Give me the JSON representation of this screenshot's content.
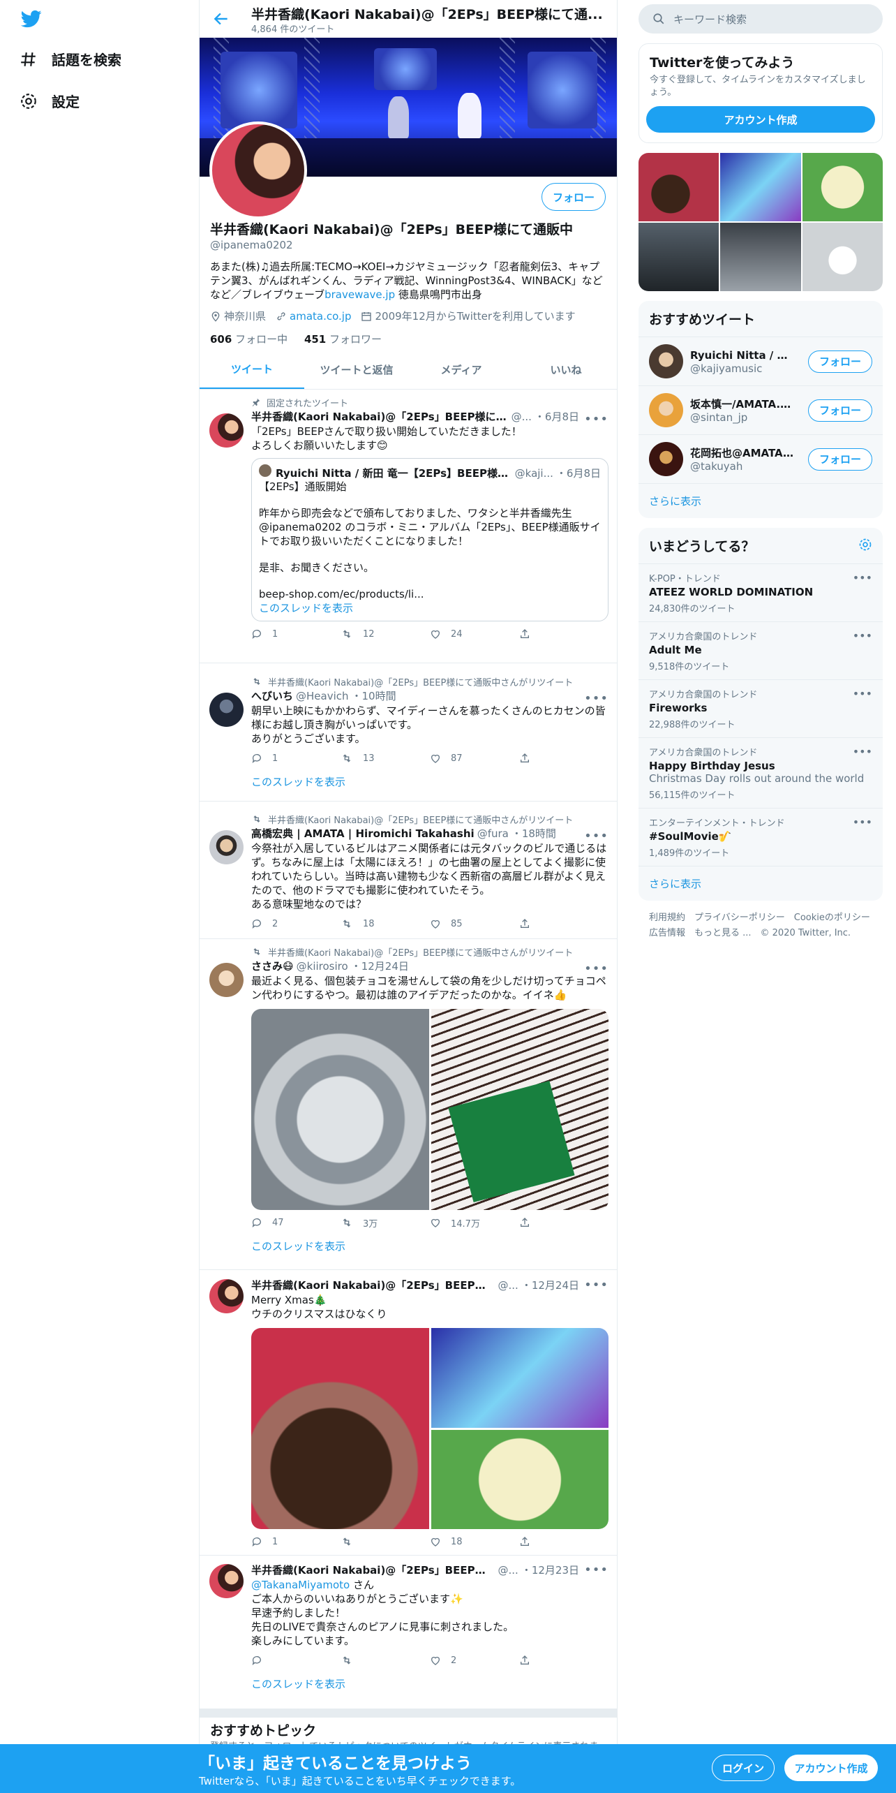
{
  "nav": {
    "explore": "話題を検索",
    "settings": "設定"
  },
  "header": {
    "title": "半井香織(Kaori Nakabai)@「2EPs」BEEP様にて通...",
    "subtitle": "4,864 件のツイート"
  },
  "profile": {
    "follow": "フォロー",
    "name": "半井香織(Kaori Nakabai)@「2EPs」BEEP様にて通販中",
    "handle": "@ipanema0202",
    "bio": "あまた(株)♫過去所属:TECMO→KOEI→カジヤミュージック「忍者龍剣伝3、キャプテン翼3、がんばれギンくん、ラディア戦記、WinningPost3&4、WINBACK」などなど／ブレイブウェーブ",
    "bio_link": "bravewave.jp",
    "bio_tail": " 徳島県鳴門市出身",
    "location": "神奈川県",
    "url": "amata.co.jp",
    "joined": "2009年12月からTwitterを利用しています",
    "following_count": "606",
    "following_label": " フォロー中",
    "followers_count": "451",
    "followers_label": " フォロワー"
  },
  "tabs": [
    "ツイート",
    "ツイートと返信",
    "メディア",
    "いいね"
  ],
  "tweets": {
    "t1": {
      "pinned": "固定されたツイート",
      "name": "半井香織(Kaori Nakabai)@「2EPs」BEEP様にて通販中",
      "handle": "@...",
      "time": "・6月8日",
      "text1": "「2EPs」BEEPさんで取り扱い開始していただきました！",
      "text2": "よろしくお願いいたします😊",
      "quote": {
        "name": "Ryuichi Nitta / 新田 竜一【2EPs】BEEP様にて通販中",
        "handle": "@kaji...",
        "time": "・6月8日",
        "l1": "【2EPs】通販開始",
        "l2": "昨年から即売会などで頒布しておりました、ワタシと半井香織先生@ipanema0202 のコラボ・ミニ・アルバム「2EPs」、BEEP様通販サイトでお取り扱いいただくことになりました！",
        "l3": "是非、お聞きください。",
        "l4": "beep-shop.com/ec/products/li...",
        "thread": "このスレッドを表示"
      },
      "replies": "1",
      "retweets": "12",
      "likes": "24"
    },
    "t2": {
      "ctx": "半井香織(Kaori Nakabai)@「2EPs」BEEP様にて通販中さんがリツイート",
      "name": "へびいち",
      "handle": "@Heavich",
      "time": "・10時間",
      "text": "朝早い上映にもかかわらず、マイディーさんを慕ったくさんのヒカセンの皆様にお越し頂き胸がいっぱいです。",
      "text2": "ありがとうございます。",
      "replies": "1",
      "retweets": "13",
      "likes": "87",
      "thread": "このスレッドを表示"
    },
    "t3": {
      "ctx": "半井香織(Kaori Nakabai)@「2EPs」BEEP様にて通販中さんがリツイート",
      "name": "高橋宏典 | AMATA | Hiromichi Takahashi",
      "handle": "@fura",
      "time": "・18時間",
      "text": "今祭社が入居しているビルはアニメ関係者には元タバックのビルで通じるはず。ちなみに屋上は「太陽にほえろ！」の七曲署の屋上としてよく撮影に使われていたらしい。当時は高い建物も少なく西新宿の高層ビル群がよく見えたので、他のドラマでも撮影に使われていたそう。",
      "text2": "ある意味聖地なのでは？",
      "replies": "2",
      "retweets": "18",
      "likes": "85"
    },
    "t4": {
      "ctx": "半井香織(Kaori Nakabai)@「2EPs」BEEP様にて通販中さんがリツイート",
      "name": "ささみ😷",
      "handle": "@kiirosiro",
      "time": "・12月24日",
      "text": "最近よく見る、個包装チョコを湯せんして袋の角を少しだけ切ってチョコペン代わりにするやつ。最初は誰のアイデアだったのかな。イイネ👍",
      "replies": "47",
      "retweets": "3万",
      "likes": "14.7万",
      "thread": "このスレッドを表示"
    },
    "t5": {
      "name": "半井香織(Kaori Nakabai)@「2EPs」BEEP様にて通販中",
      "handle": "@...",
      "time": "・12月24日",
      "text": "Merry Xmas🎄",
      "text2": "ウチのクリスマスはひなくり",
      "replies": "1",
      "retweets": "",
      "likes": "18"
    },
    "t6": {
      "name": "半井香織(Kaori Nakabai)@「2EPs」BEEP様にて通販中",
      "handle": "@...",
      "time": "・12月23日",
      "mention": "@TakanaMiyamoto",
      "mention_tail": " さん",
      "l1": "ご本人からのいいねありがとうございます✨",
      "l2": "早速予約しました！",
      "l3": "先日のLIVEで貴奈さんのピアノに見事に刺されました。",
      "l4": "楽しみにしています。",
      "replies": "",
      "retweets": "",
      "likes": "2",
      "thread": "このスレッドを表示"
    }
  },
  "topics": {
    "title": "おすすめトピック",
    "sub": "登録すると、フォローしているトピックについてのツイートがホームタイムラインに表示されま"
  },
  "sidebar": {
    "search_placeholder": "キーワード検索",
    "signup_box": {
      "title": "Twitterを使ってみよう",
      "text": "今すぐ登録して、タイムラインをカスタマイズしましょう。",
      "button": "アカウント作成"
    },
    "who_to_follow": {
      "title": "おすすめツイート",
      "users": [
        {
          "name": "Ryuichi Nitta / 新田 ...",
          "handle": "@kajiyamusic",
          "button": "フォロー"
        },
        {
          "name": "坂本慎一/AMATA.伯...",
          "handle": "@sintan_jp",
          "button": "フォロー"
        },
        {
          "name": "花岡拓也@AMATA.伯...",
          "handle": "@takuyah",
          "button": "フォロー"
        }
      ],
      "more": "さらに表示"
    },
    "trends": {
      "title": "いまどうしてる？",
      "items": [
        {
          "cat": "K-POP・トレンド",
          "name": "ATEEZ WORLD DOMINATION",
          "desc": "",
          "count": "24,830件のツイート"
        },
        {
          "cat": "アメリカ合衆国のトレンド",
          "name": "Adult Me",
          "desc": "",
          "count": "9,518件のツイート"
        },
        {
          "cat": "アメリカ合衆国のトレンド",
          "name": "Fireworks",
          "desc": "",
          "count": "22,988件のツイート"
        },
        {
          "cat": "アメリカ合衆国のトレンド",
          "name": "Happy Birthday Jesus",
          "desc": "Christmas Day rolls out around the world",
          "count": "56,115件のツイート"
        },
        {
          "cat": "エンターテインメント・トレンド",
          "name": "#SoulMovie🎷",
          "desc": "",
          "count": "1,489件のツイート"
        }
      ],
      "more": "さらに表示"
    },
    "footer": {
      "l1": "利用規約　プライバシーポリシー　Cookieのポリシー",
      "l2": "広告情報　もっと見る ...　© 2020 Twitter, Inc."
    }
  },
  "bottombar": {
    "title": "「いま」起きていることを見つけよう",
    "sub": "Twitterなら、「いま」起きていることをいち早くチェックできます。",
    "login": "ログイン",
    "signup": "アカウント作成"
  },
  "colors": {
    "accent": "#1da1f2",
    "text": "#14171a",
    "muted": "#657786",
    "border": "#e6ecf0"
  }
}
